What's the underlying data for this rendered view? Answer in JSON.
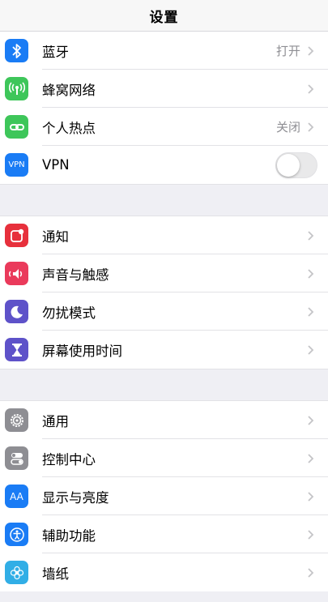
{
  "header": {
    "title": "设置"
  },
  "groups": [
    {
      "items": [
        {
          "label": "蓝牙",
          "value": "打开",
          "icon": "bluetooth-icon",
          "color": "#1a7cf5"
        },
        {
          "label": "蜂窝网络",
          "value": "",
          "icon": "cellular-icon",
          "color": "#3ec65a"
        },
        {
          "label": "个人热点",
          "value": "关闭",
          "icon": "hotspot-icon",
          "color": "#3ec65a"
        },
        {
          "label": "VPN",
          "value": "",
          "icon": "vpn-icon",
          "color": "#1a7cf5",
          "icon_text": "VPN",
          "toggle": "off"
        }
      ]
    },
    {
      "items": [
        {
          "label": "通知",
          "icon": "notifications-icon",
          "color": "#e7303c"
        },
        {
          "label": "声音与触感",
          "icon": "sound-icon",
          "color": "#ea3a5b"
        },
        {
          "label": "勿扰模式",
          "icon": "moon-icon",
          "color": "#5e52c9"
        },
        {
          "label": "屏幕使用时间",
          "icon": "hourglass-icon",
          "color": "#5e52c9"
        }
      ]
    },
    {
      "items": [
        {
          "label": "通用",
          "icon": "gear-icon",
          "color": "#8e8e93"
        },
        {
          "label": "控制中心",
          "icon": "control-center-icon",
          "color": "#8e8e93"
        },
        {
          "label": "显示与亮度",
          "icon": "display-icon",
          "color": "#1a7cf5",
          "icon_text": "AA"
        },
        {
          "label": "辅助功能",
          "icon": "accessibility-icon",
          "color": "#1a7cf5"
        },
        {
          "label": "墙纸",
          "icon": "wallpaper-icon",
          "color": "#31aee6"
        }
      ]
    }
  ]
}
